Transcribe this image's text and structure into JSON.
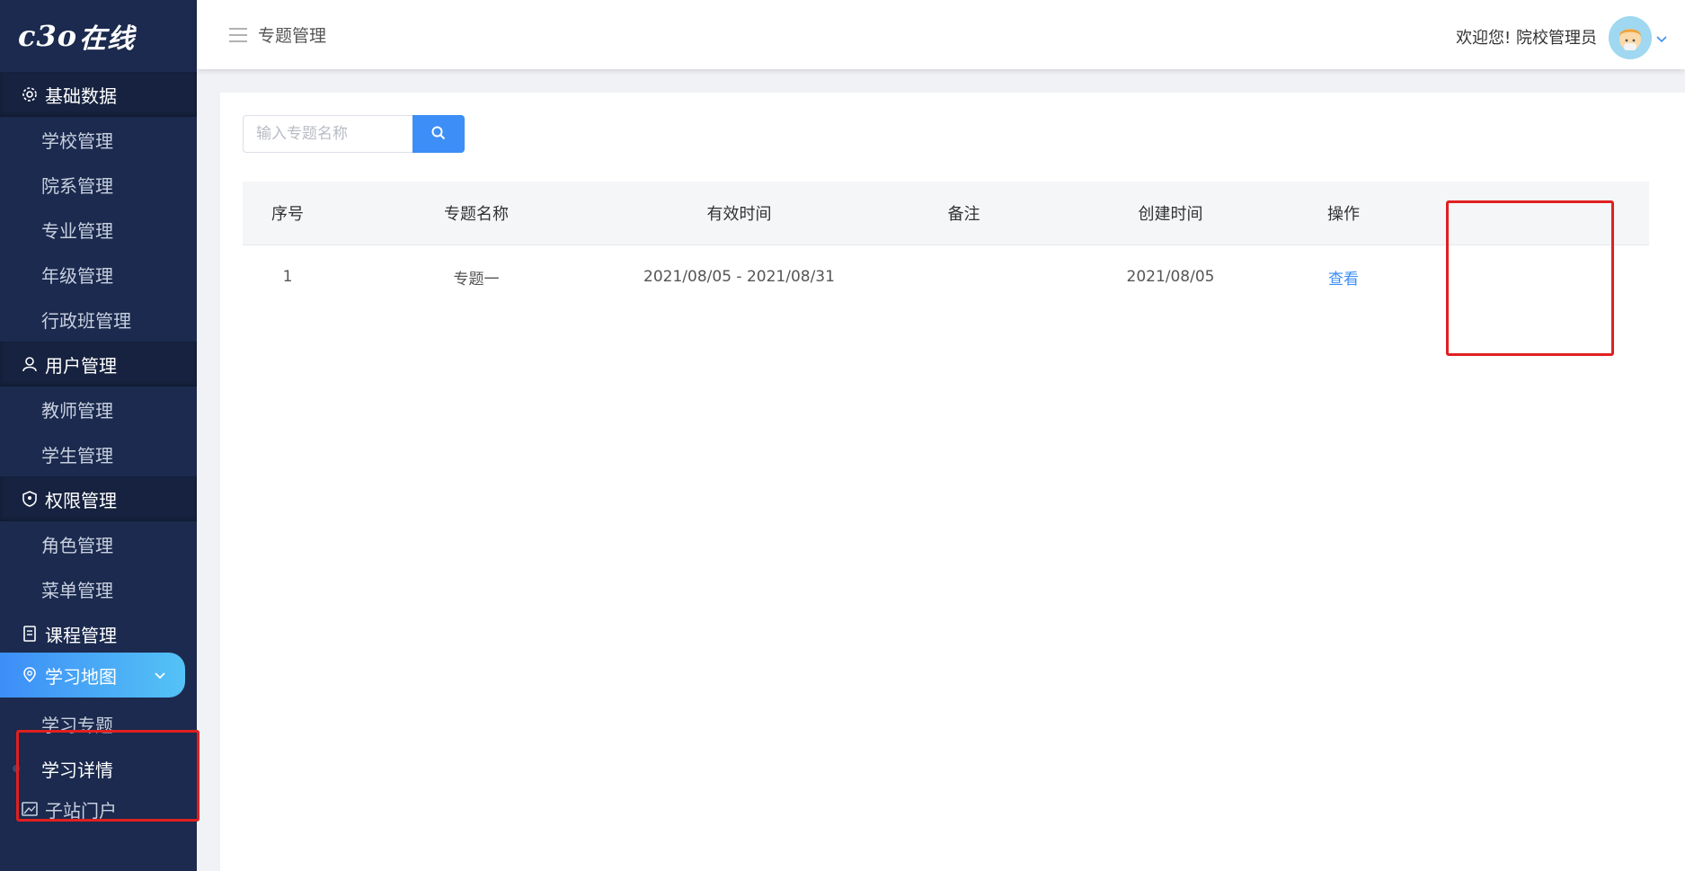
{
  "brand": {
    "logo_text": "在线",
    "logo_mark": "c3o"
  },
  "header": {
    "breadcrumb": "专题管理",
    "welcome": "欢迎您!  院校管理员"
  },
  "sidebar": {
    "groups": [
      {
        "label": "基础数据",
        "icon": "gear-icon",
        "items": [
          "学校管理",
          "院系管理",
          "专业管理",
          "年级管理",
          "行政班管理"
        ]
      },
      {
        "label": "用户管理",
        "icon": "user-icon",
        "items": [
          "教师管理",
          "学生管理"
        ]
      },
      {
        "label": "权限管理",
        "icon": "shield-icon",
        "items": [
          "角色管理",
          "菜单管理"
        ]
      },
      {
        "label": "课程管理",
        "icon": "book-icon",
        "items": []
      },
      {
        "label": "学习地图",
        "icon": "map-icon",
        "items": [
          "学习专题",
          "学习详情"
        ],
        "expanded": true
      },
      {
        "label": "子站门户",
        "icon": "image-icon",
        "items": []
      }
    ],
    "active_group": "学习地图",
    "current_item": "学习详情"
  },
  "search": {
    "placeholder": "输入专题名称",
    "value": ""
  },
  "table": {
    "columns": [
      "序号",
      "专题名称",
      "有效时间",
      "备注",
      "创建时间",
      "操作"
    ],
    "rows": [
      {
        "index": "1",
        "name": "专题一",
        "period": "2021/08/05 - 2021/08/31",
        "remark": "",
        "created": "2021/08/05",
        "action": "查看"
      }
    ]
  },
  "colors": {
    "sidebar_bg": "#1b2a4e",
    "accent": "#3d8ef7",
    "highlight_box": "#e02020"
  }
}
